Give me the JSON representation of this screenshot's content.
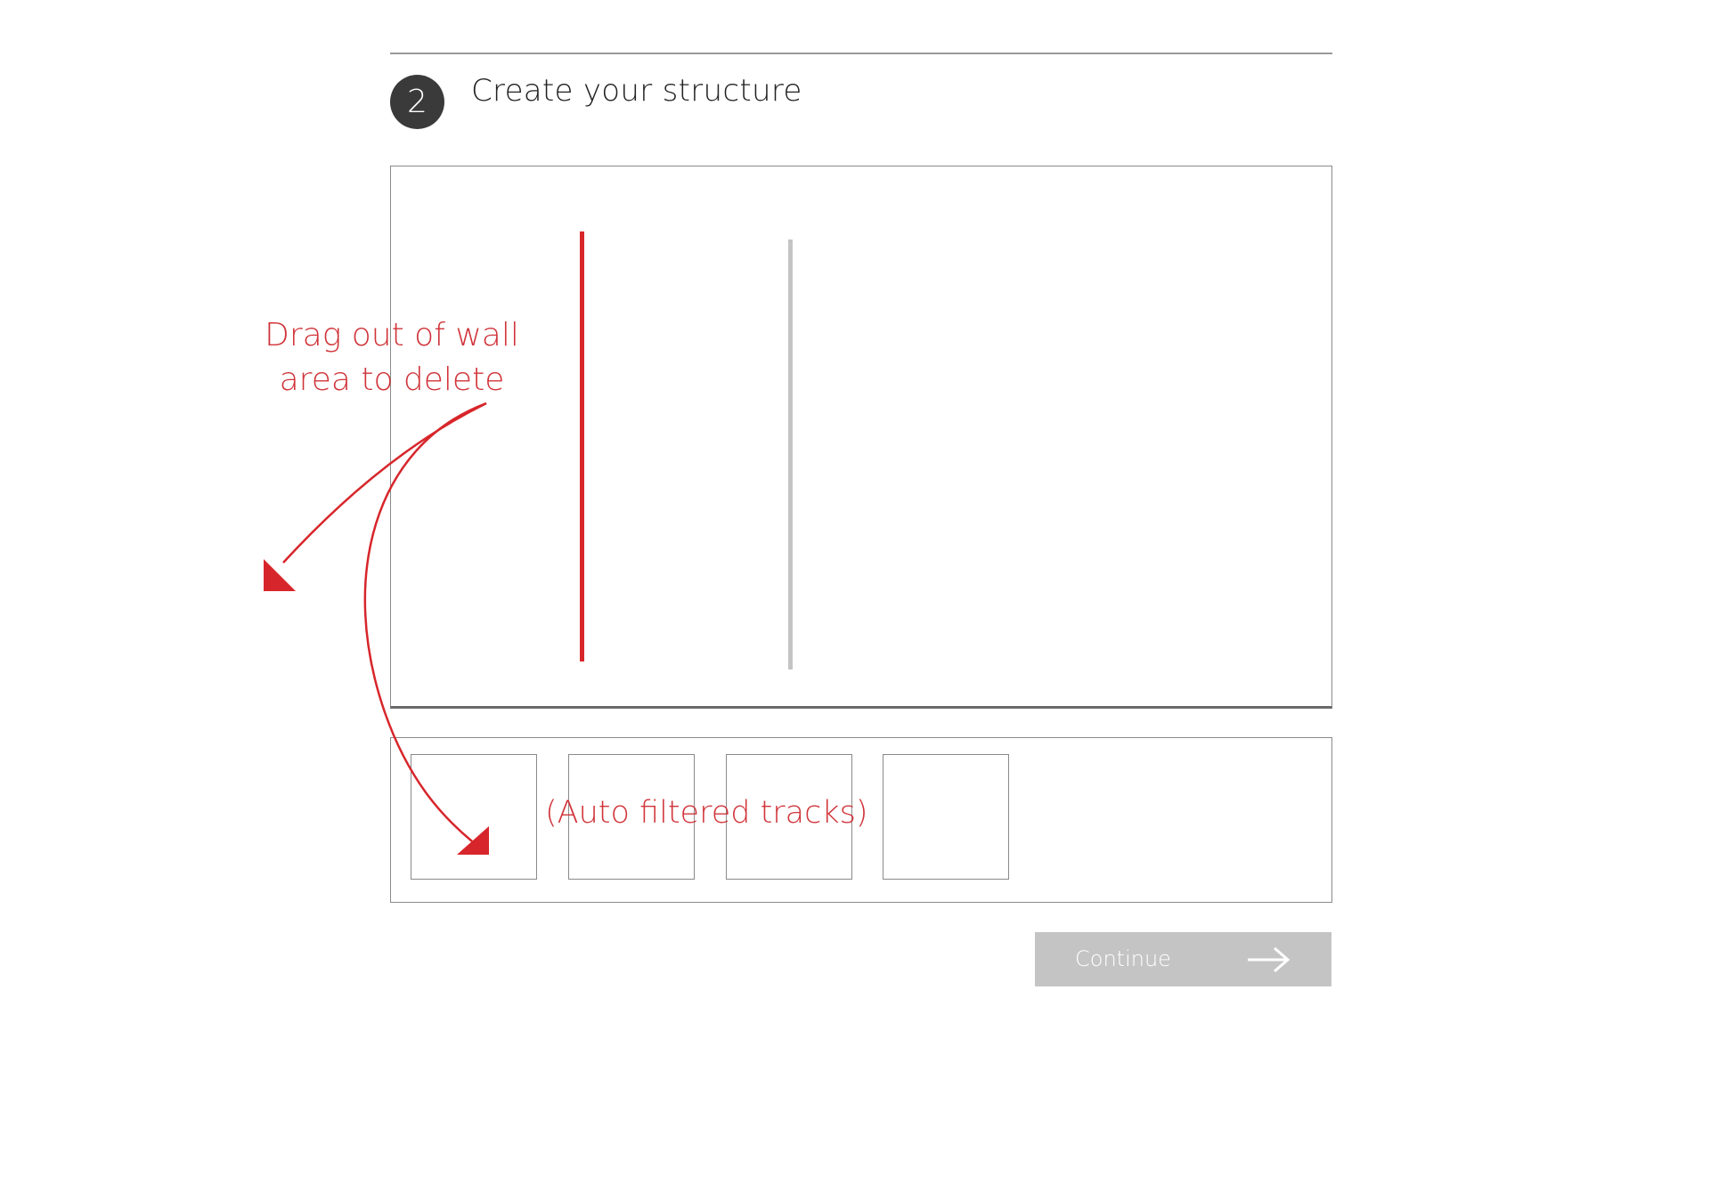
{
  "step": {
    "number": "2",
    "title": "Create your structure"
  },
  "wall": {
    "tracks": [
      {
        "state": "selected",
        "color": "#d7262b"
      },
      {
        "state": "normal",
        "color": "#c4c4c4"
      }
    ]
  },
  "tray": {
    "slots": 4,
    "note": "(Auto filtered tracks)"
  },
  "annotation": {
    "line1": "Drag out of wall",
    "line2": "area to delete",
    "color": "#d0343a"
  },
  "actions": {
    "continue_label": "Continue",
    "continue_icon": "arrow-right-icon",
    "continue_color": "#c4c4c4"
  }
}
